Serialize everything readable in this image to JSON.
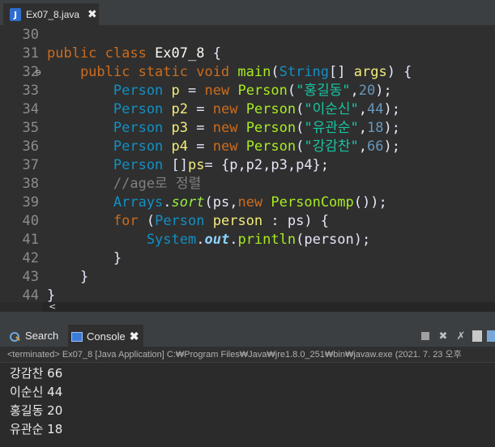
{
  "editor_tab": {
    "title": "Ex07_8.java",
    "close": "✖",
    "icon": "java-file-icon"
  },
  "code": [
    {
      "ln": "30",
      "tokens": []
    },
    {
      "ln": "31",
      "tokens": [
        [
          "kw",
          "public class "
        ],
        [
          "ident",
          "Ex07_8 "
        ],
        [
          "tx",
          "{"
        ]
      ]
    },
    {
      "ln": "32",
      "marker": "⊖",
      "tokens": [
        [
          "kw",
          "    public static void "
        ],
        [
          "mth",
          "main"
        ],
        [
          "tx",
          "("
        ],
        [
          "ty",
          "String"
        ],
        [
          "tx",
          "[] "
        ],
        [
          "var-def",
          "args"
        ],
        [
          "tx",
          ") {"
        ]
      ]
    },
    {
      "ln": "33",
      "tokens": [
        [
          "ty",
          "        Person "
        ],
        [
          "var-def",
          "p "
        ],
        [
          "tx",
          "= "
        ],
        [
          "kw",
          "new "
        ],
        [
          "mth",
          "Person"
        ],
        [
          "tx",
          "("
        ],
        [
          "str",
          "\"홍길동\""
        ],
        [
          "tx",
          ","
        ],
        [
          "num",
          "20"
        ],
        [
          "tx",
          ");"
        ]
      ]
    },
    {
      "ln": "34",
      "tokens": [
        [
          "ty",
          "        Person "
        ],
        [
          "var-def",
          "p2 "
        ],
        [
          "tx",
          "= "
        ],
        [
          "kw",
          "new "
        ],
        [
          "mth",
          "Person"
        ],
        [
          "tx",
          "("
        ],
        [
          "str",
          "\"이순신\""
        ],
        [
          "tx",
          ","
        ],
        [
          "num",
          "44"
        ],
        [
          "tx",
          ");"
        ]
      ]
    },
    {
      "ln": "35",
      "tokens": [
        [
          "ty",
          "        Person "
        ],
        [
          "var-def",
          "p3 "
        ],
        [
          "tx",
          "= "
        ],
        [
          "kw",
          "new "
        ],
        [
          "mth",
          "Person"
        ],
        [
          "tx",
          "("
        ],
        [
          "str",
          "\"유관순\""
        ],
        [
          "tx",
          ","
        ],
        [
          "num",
          "18"
        ],
        [
          "tx",
          ");"
        ]
      ]
    },
    {
      "ln": "36",
      "tokens": [
        [
          "ty",
          "        Person "
        ],
        [
          "var-def",
          "p4 "
        ],
        [
          "tx",
          "= "
        ],
        [
          "kw",
          "new "
        ],
        [
          "mth",
          "Person"
        ],
        [
          "tx",
          "("
        ],
        [
          "str",
          "\"강감찬\""
        ],
        [
          "tx",
          ","
        ],
        [
          "num",
          "66"
        ],
        [
          "tx",
          ");"
        ]
      ]
    },
    {
      "ln": "37",
      "tokens": [
        [
          "ty",
          "        Person "
        ],
        [
          "tx",
          "[]"
        ],
        [
          "var-def",
          "ps"
        ],
        [
          "tx",
          "= {p,p2,p3,p4};"
        ]
      ]
    },
    {
      "ln": "38",
      "tokens": [
        [
          "cmt",
          "        //age로 정렬"
        ]
      ]
    },
    {
      "ln": "39",
      "tokens": [
        [
          "ty",
          "        Arrays"
        ],
        [
          "tx",
          "."
        ],
        [
          "ital",
          "sort"
        ],
        [
          "tx",
          "(ps,"
        ],
        [
          "kw",
          "new "
        ],
        [
          "mth",
          "PersonComp"
        ],
        [
          "tx",
          "());"
        ]
      ]
    },
    {
      "ln": "40",
      "tokens": [
        [
          "kw",
          "        for "
        ],
        [
          "tx",
          "("
        ],
        [
          "ty",
          "Person "
        ],
        [
          "var-def",
          "person "
        ],
        [
          "tx",
          ": ps) {"
        ]
      ]
    },
    {
      "ln": "41",
      "tokens": [
        [
          "ty",
          "            System"
        ],
        [
          "tx",
          "."
        ],
        [
          "stat",
          "out"
        ],
        [
          "tx",
          "."
        ],
        [
          "mth",
          "println"
        ],
        [
          "tx",
          "(person);"
        ]
      ]
    },
    {
      "ln": "42",
      "tokens": [
        [
          "tx",
          "        }"
        ]
      ]
    },
    {
      "ln": "43",
      "tokens": [
        [
          "tx",
          "    }"
        ]
      ]
    },
    {
      "ln": "44",
      "tokens": [
        [
          "tx",
          "}"
        ]
      ]
    }
  ],
  "scroll_left": "<",
  "panel": {
    "search_tab": "Search",
    "console_tab": "Console",
    "close": "✖",
    "header": "<terminated> Ex07_8 [Java Application] C:₩Program Files₩Java₩jre1.8.0_251₩bin₩javaw.exe  (2021. 7. 23 오후",
    "output": [
      "강감찬 66",
      "이순신 44",
      "홍길동 20",
      "유관순 18"
    ]
  },
  "toolbar": {
    "remove_label": "✖",
    "remove_all_label": "✗",
    "icons": [
      "terminate-icon",
      "remove-launch-icon",
      "remove-all-terminated-icon",
      "scroll-lock-icon"
    ]
  }
}
